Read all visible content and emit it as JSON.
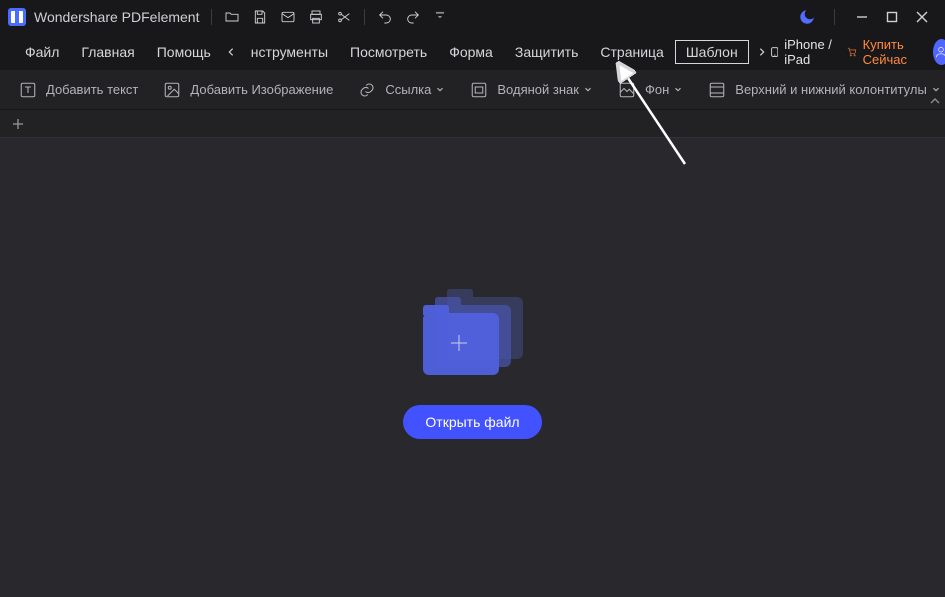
{
  "title_bar": {
    "app_name": "Wondershare PDFelement"
  },
  "menu": {
    "items": [
      "Файл",
      "Главная",
      "Помощь"
    ],
    "scrolled_items": [
      "нструменты",
      "Посмотреть",
      "Форма",
      "Защитить",
      "Страница"
    ],
    "highlighted": "Шаблон",
    "iphone_label": "iPhone / iPad",
    "buy_now": "Купить Сейчас"
  },
  "tools": {
    "add_text": "Добавить текст",
    "add_image": "Добавить Изображение",
    "link": "Ссылка",
    "watermark": "Водяной знак",
    "background": "Фон",
    "header_footer": "Верхний и нижний колонтитулы"
  },
  "main": {
    "open_file": "Открыть файл"
  }
}
